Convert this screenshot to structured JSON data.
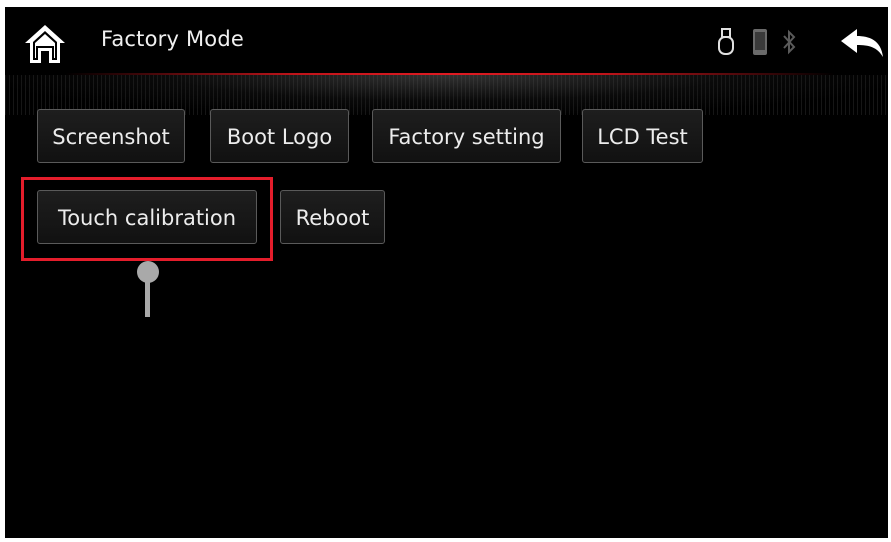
{
  "header": {
    "title": "Factory Mode",
    "home_icon": "home-icon",
    "back_icon": "back-arrow-icon",
    "status_icons": [
      "usb-icon",
      "phone-icon",
      "bluetooth-icon"
    ],
    "accent_color": "#e01b22"
  },
  "buttons": {
    "screenshot": "Screenshot",
    "boot_logo": "Boot Logo",
    "factory_setting": "Factory setting",
    "lcd_test": "LCD Test",
    "touch_calibration": "Touch calibration",
    "reboot": "Reboot"
  },
  "annotation": {
    "highlight_color": "#e41d2b",
    "highlighted_item": "Touch calibration"
  }
}
